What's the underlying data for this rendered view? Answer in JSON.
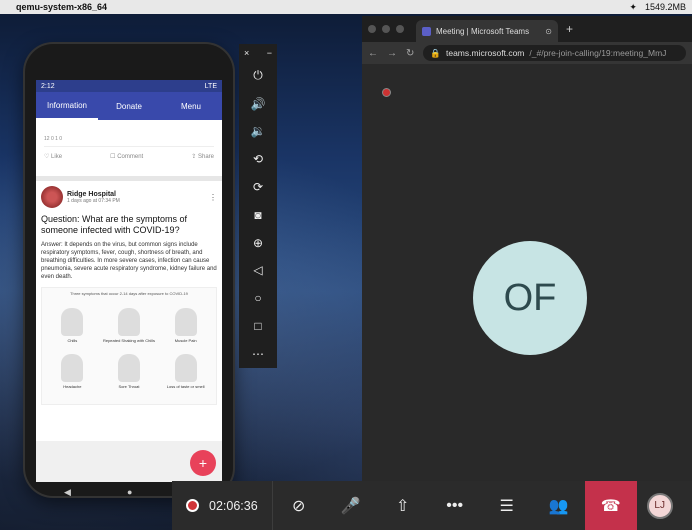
{
  "menubar": {
    "app_name": "qemu-system-x86_64",
    "right_text": "1549.2MB"
  },
  "phone": {
    "time": "2:12",
    "signal": "LTE",
    "tabs": [
      "Information",
      "Donate",
      "Menu"
    ],
    "card1": {
      "stats": "12  0  1  0",
      "like": "Like",
      "comment": "Comment",
      "share": "Share"
    },
    "post": {
      "org": "Ridge Hospital",
      "meta": "1 days ago at 07:34 PM",
      "question": "Question: What are the symptoms of someone infected with COVID-19?",
      "answer": "Answer: It depends on the virus, but common signs include respiratory symptoms, fever, cough, shortness of breath, and breathing difficulties. In more severe cases, infection can cause pneumonia, severe acute respiratory syndrome, kidney failure and even death.",
      "infographic_header": "Three symptoms that occur 2-14 days after exposure to COVID-19",
      "symptoms": [
        "Chills",
        "Repeated Shaking with Chills",
        "Muscle Pain",
        "Headache",
        "Sore Throat",
        "Loss of taste or smell"
      ]
    }
  },
  "teams": {
    "tab_title": "Meeting | Microsoft Teams",
    "url_host": "teams.microsoft.com",
    "url_path": "/_#/pre-join-calling/19:meeting_MmJ",
    "avatar_initials": "OF",
    "timer": "02:06:36",
    "me_initials": "LJ"
  }
}
